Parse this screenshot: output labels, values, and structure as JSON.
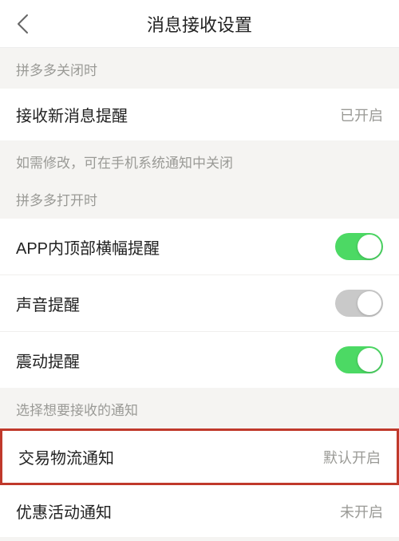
{
  "header": {
    "title": "消息接收设置"
  },
  "sections": {
    "closed_label": "拼多多关闭时",
    "new_msg": {
      "label": "接收新消息提醒",
      "status": "已开启"
    },
    "hint": "如需修改，可在手机系统通知中关闭",
    "open_label": "拼多多打开时",
    "banner": {
      "label": "APP内顶部横幅提醒",
      "on": true
    },
    "sound": {
      "label": "声音提醒",
      "on": false
    },
    "vibrate": {
      "label": "震动提醒",
      "on": true
    },
    "choose_label": "选择想要接收的通知",
    "trade": {
      "label": "交易物流通知",
      "status": "默认开启"
    },
    "promo": {
      "label": "优惠活动通知",
      "status": "未开启"
    }
  }
}
